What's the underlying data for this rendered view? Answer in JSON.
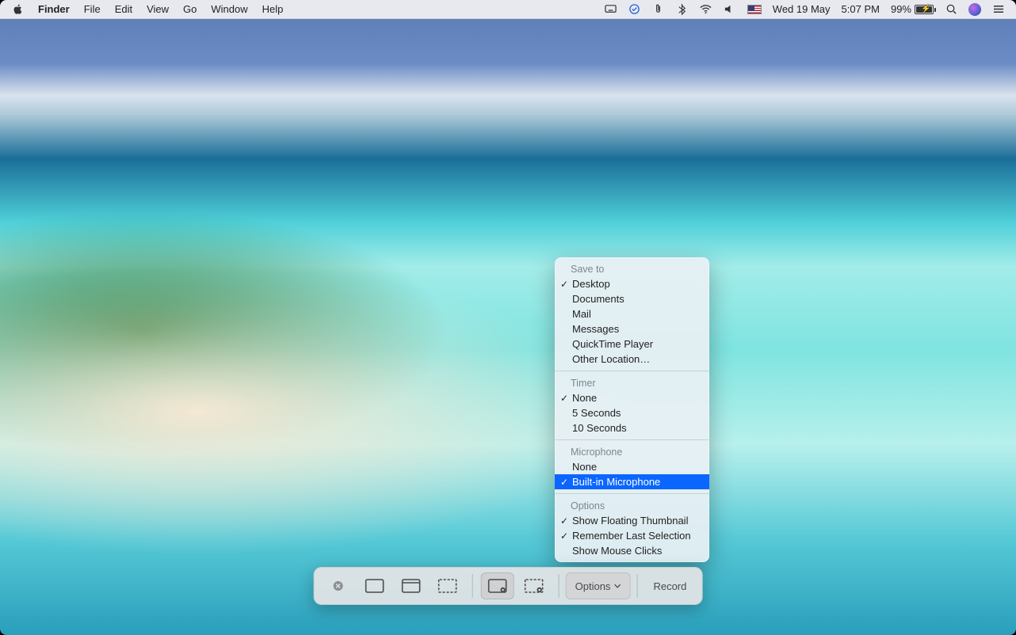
{
  "menubar": {
    "app": "Finder",
    "items": [
      "File",
      "Edit",
      "View",
      "Go",
      "Window",
      "Help"
    ],
    "date": "Wed 19 May",
    "time": "5:07 PM",
    "battery": "99%"
  },
  "toolbar": {
    "options_label": "Options",
    "record_label": "Record"
  },
  "popup": {
    "sections": [
      {
        "label": "Save to",
        "items": [
          {
            "text": "Desktop",
            "checked": true
          },
          {
            "text": "Documents",
            "checked": false
          },
          {
            "text": "Mail",
            "checked": false
          },
          {
            "text": "Messages",
            "checked": false
          },
          {
            "text": "QuickTime Player",
            "checked": false
          },
          {
            "text": "Other Location…",
            "checked": false
          }
        ]
      },
      {
        "label": "Timer",
        "items": [
          {
            "text": "None",
            "checked": true
          },
          {
            "text": "5 Seconds",
            "checked": false
          },
          {
            "text": "10 Seconds",
            "checked": false
          }
        ]
      },
      {
        "label": "Microphone",
        "items": [
          {
            "text": "None",
            "checked": false
          },
          {
            "text": "Built-in Microphone",
            "checked": true,
            "highlight": true
          }
        ]
      },
      {
        "label": "Options",
        "items": [
          {
            "text": "Show Floating Thumbnail",
            "checked": true
          },
          {
            "text": "Remember Last Selection",
            "checked": true
          },
          {
            "text": "Show Mouse Clicks",
            "checked": false
          }
        ]
      }
    ]
  }
}
